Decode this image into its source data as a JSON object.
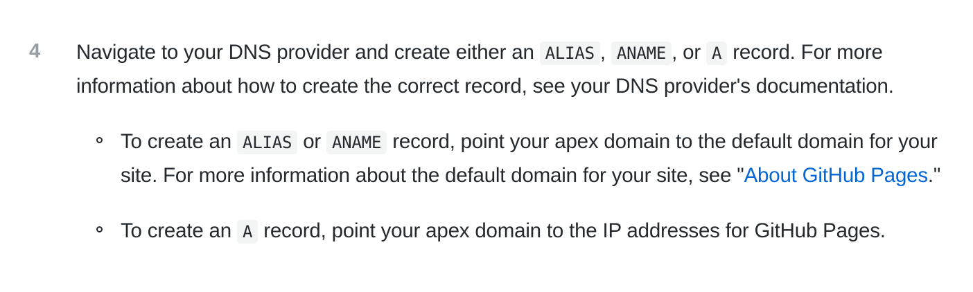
{
  "step": {
    "number": "4",
    "intro": {
      "t1": "Navigate to your DNS provider and create either an ",
      "code1": "ALIAS",
      "t2": ", ",
      "code2": "ANAME",
      "t3": ", or ",
      "code3": "A",
      "t4": " record. For more information about how to create the correct record, see your DNS provider's documentation."
    },
    "bullets": [
      {
        "t1": "To create an ",
        "code1": "ALIAS",
        "t2": " or ",
        "code2": "ANAME",
        "t3": " record, point your apex domain to the default domain for your site. For more information about the default domain for your site, see \"",
        "link": "About GitHub Pages",
        "t4": ".\""
      },
      {
        "t1": "To create an ",
        "code1": "A",
        "t2": " record, point your apex domain to the IP addresses for GitHub Pages."
      }
    ]
  },
  "colors": {
    "text": "#24292e",
    "step_number": "#959da5",
    "link": "#0366d6",
    "code_bg": "#f3f4f4"
  }
}
